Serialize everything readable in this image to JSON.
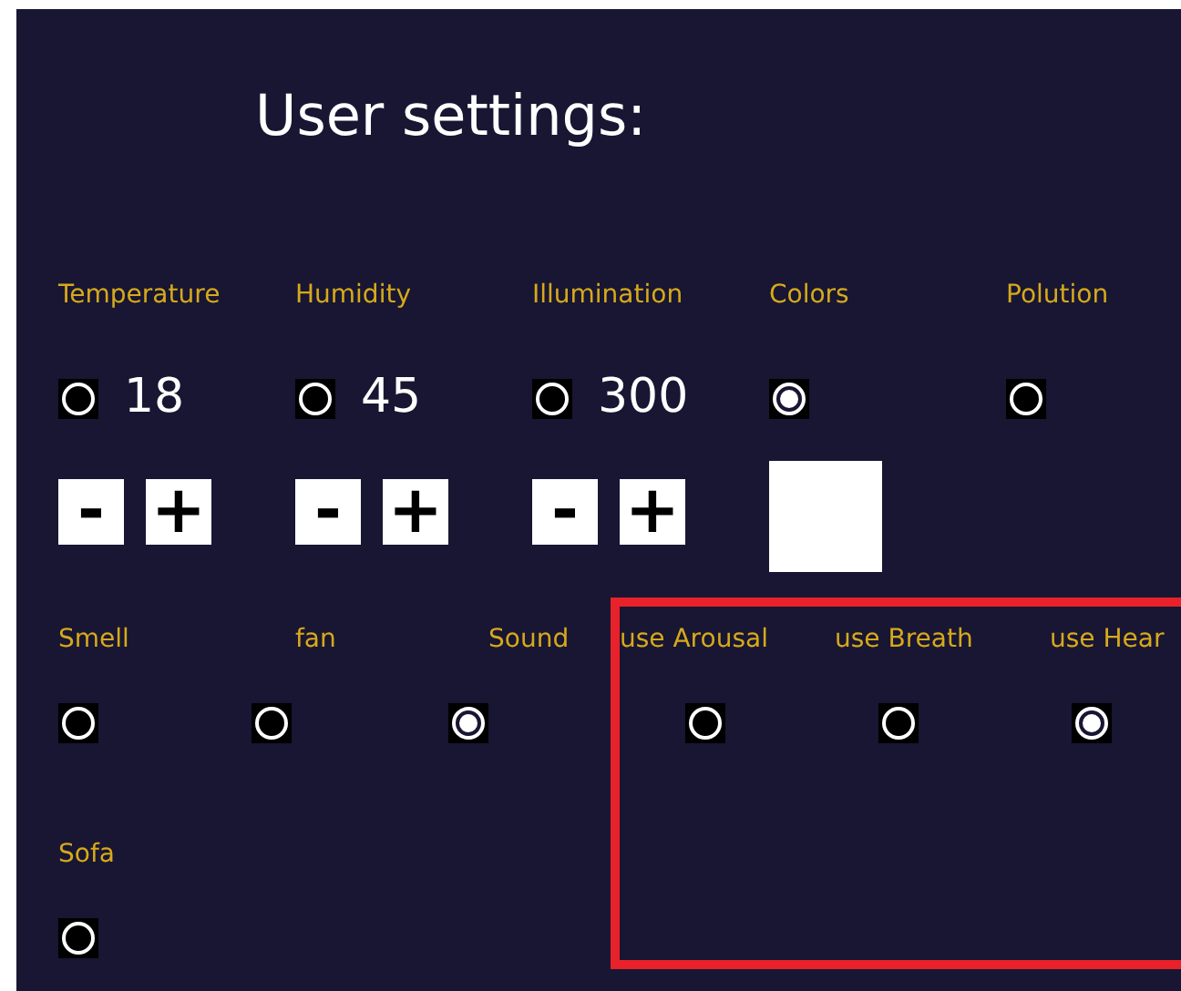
{
  "title": "User settings:",
  "rows": [
    {
      "items": [
        {
          "kind": "stepper",
          "label": "Temperature",
          "selected": false,
          "value": "18",
          "minus": "-",
          "plus": "+"
        },
        {
          "kind": "stepper",
          "label": "Humidity",
          "selected": false,
          "value": "45",
          "minus": "-",
          "plus": "+"
        },
        {
          "kind": "stepper",
          "label": "Illumination",
          "selected": false,
          "value": "300",
          "minus": "-",
          "plus": "+"
        },
        {
          "kind": "color",
          "label": "Colors",
          "selected": true,
          "color": "#ffffff"
        },
        {
          "kind": "toggle",
          "label": "Polution",
          "selected": false
        }
      ]
    },
    {
      "items": [
        {
          "kind": "toggle",
          "label": "Smell",
          "selected": false
        },
        {
          "kind": "toggle",
          "label": "fan",
          "selected": false
        },
        {
          "kind": "toggle",
          "label": "Sound",
          "selected": true
        },
        {
          "kind": "toggle",
          "label": "use Arousal",
          "selected": false
        },
        {
          "kind": "toggle",
          "label": "use Breath",
          "selected": false
        },
        {
          "kind": "toggle",
          "label": "use Hear",
          "selected": true
        }
      ]
    },
    {
      "items": [
        {
          "kind": "toggle",
          "label": "Sofa",
          "selected": false
        }
      ]
    }
  ],
  "annotation": {
    "kind": "box"
  }
}
